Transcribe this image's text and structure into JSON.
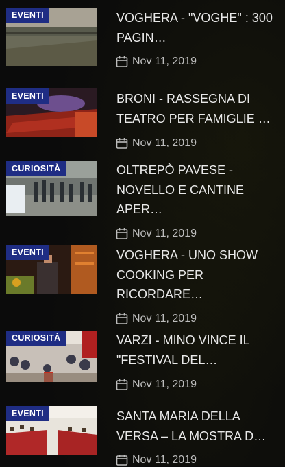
{
  "items": [
    {
      "badge": "EVENTI",
      "title": "VOGHERA - \"VOGHE\" : 300 PAGIN…",
      "date": "Nov 11, 2019",
      "thumb_icon": "stadium-photo"
    },
    {
      "badge": "EVENTI",
      "title": "BRONI - RASSEGNA DI TEATRO PER FAMIGLIE …",
      "date": "Nov 11, 2019",
      "thumb_icon": "theater-photo"
    },
    {
      "badge": "CURIOSITÀ",
      "title": "OLTREPÒ PAVESE - NOVELLO E CANTINE APER…",
      "date": "Nov 11, 2019",
      "thumb_icon": "crowd-wine-photo"
    },
    {
      "badge": "EVENTI",
      "title": "VOGHERA - UNO SHOW COOKING PER RICORDARE…",
      "date": "Nov 11, 2019",
      "thumb_icon": "cooking-show-photo"
    },
    {
      "badge": "CURIOSITÀ",
      "title": "VARZI - MINO VINCE IL \"FESTIVAL DEL…",
      "date": "Nov 11, 2019",
      "thumb_icon": "festival-hall-photo"
    },
    {
      "badge": "EVENTI",
      "title": "SANTA MARIA DELLA VERSA – LA MOSTRA D…",
      "date": "Nov 11, 2019",
      "thumb_icon": "exhibition-photo"
    }
  ],
  "colors": {
    "badge_bg": "#1f2d84",
    "title": "#e8e8e8",
    "meta": "#bdbdbd",
    "background": "#0b0b0b"
  }
}
